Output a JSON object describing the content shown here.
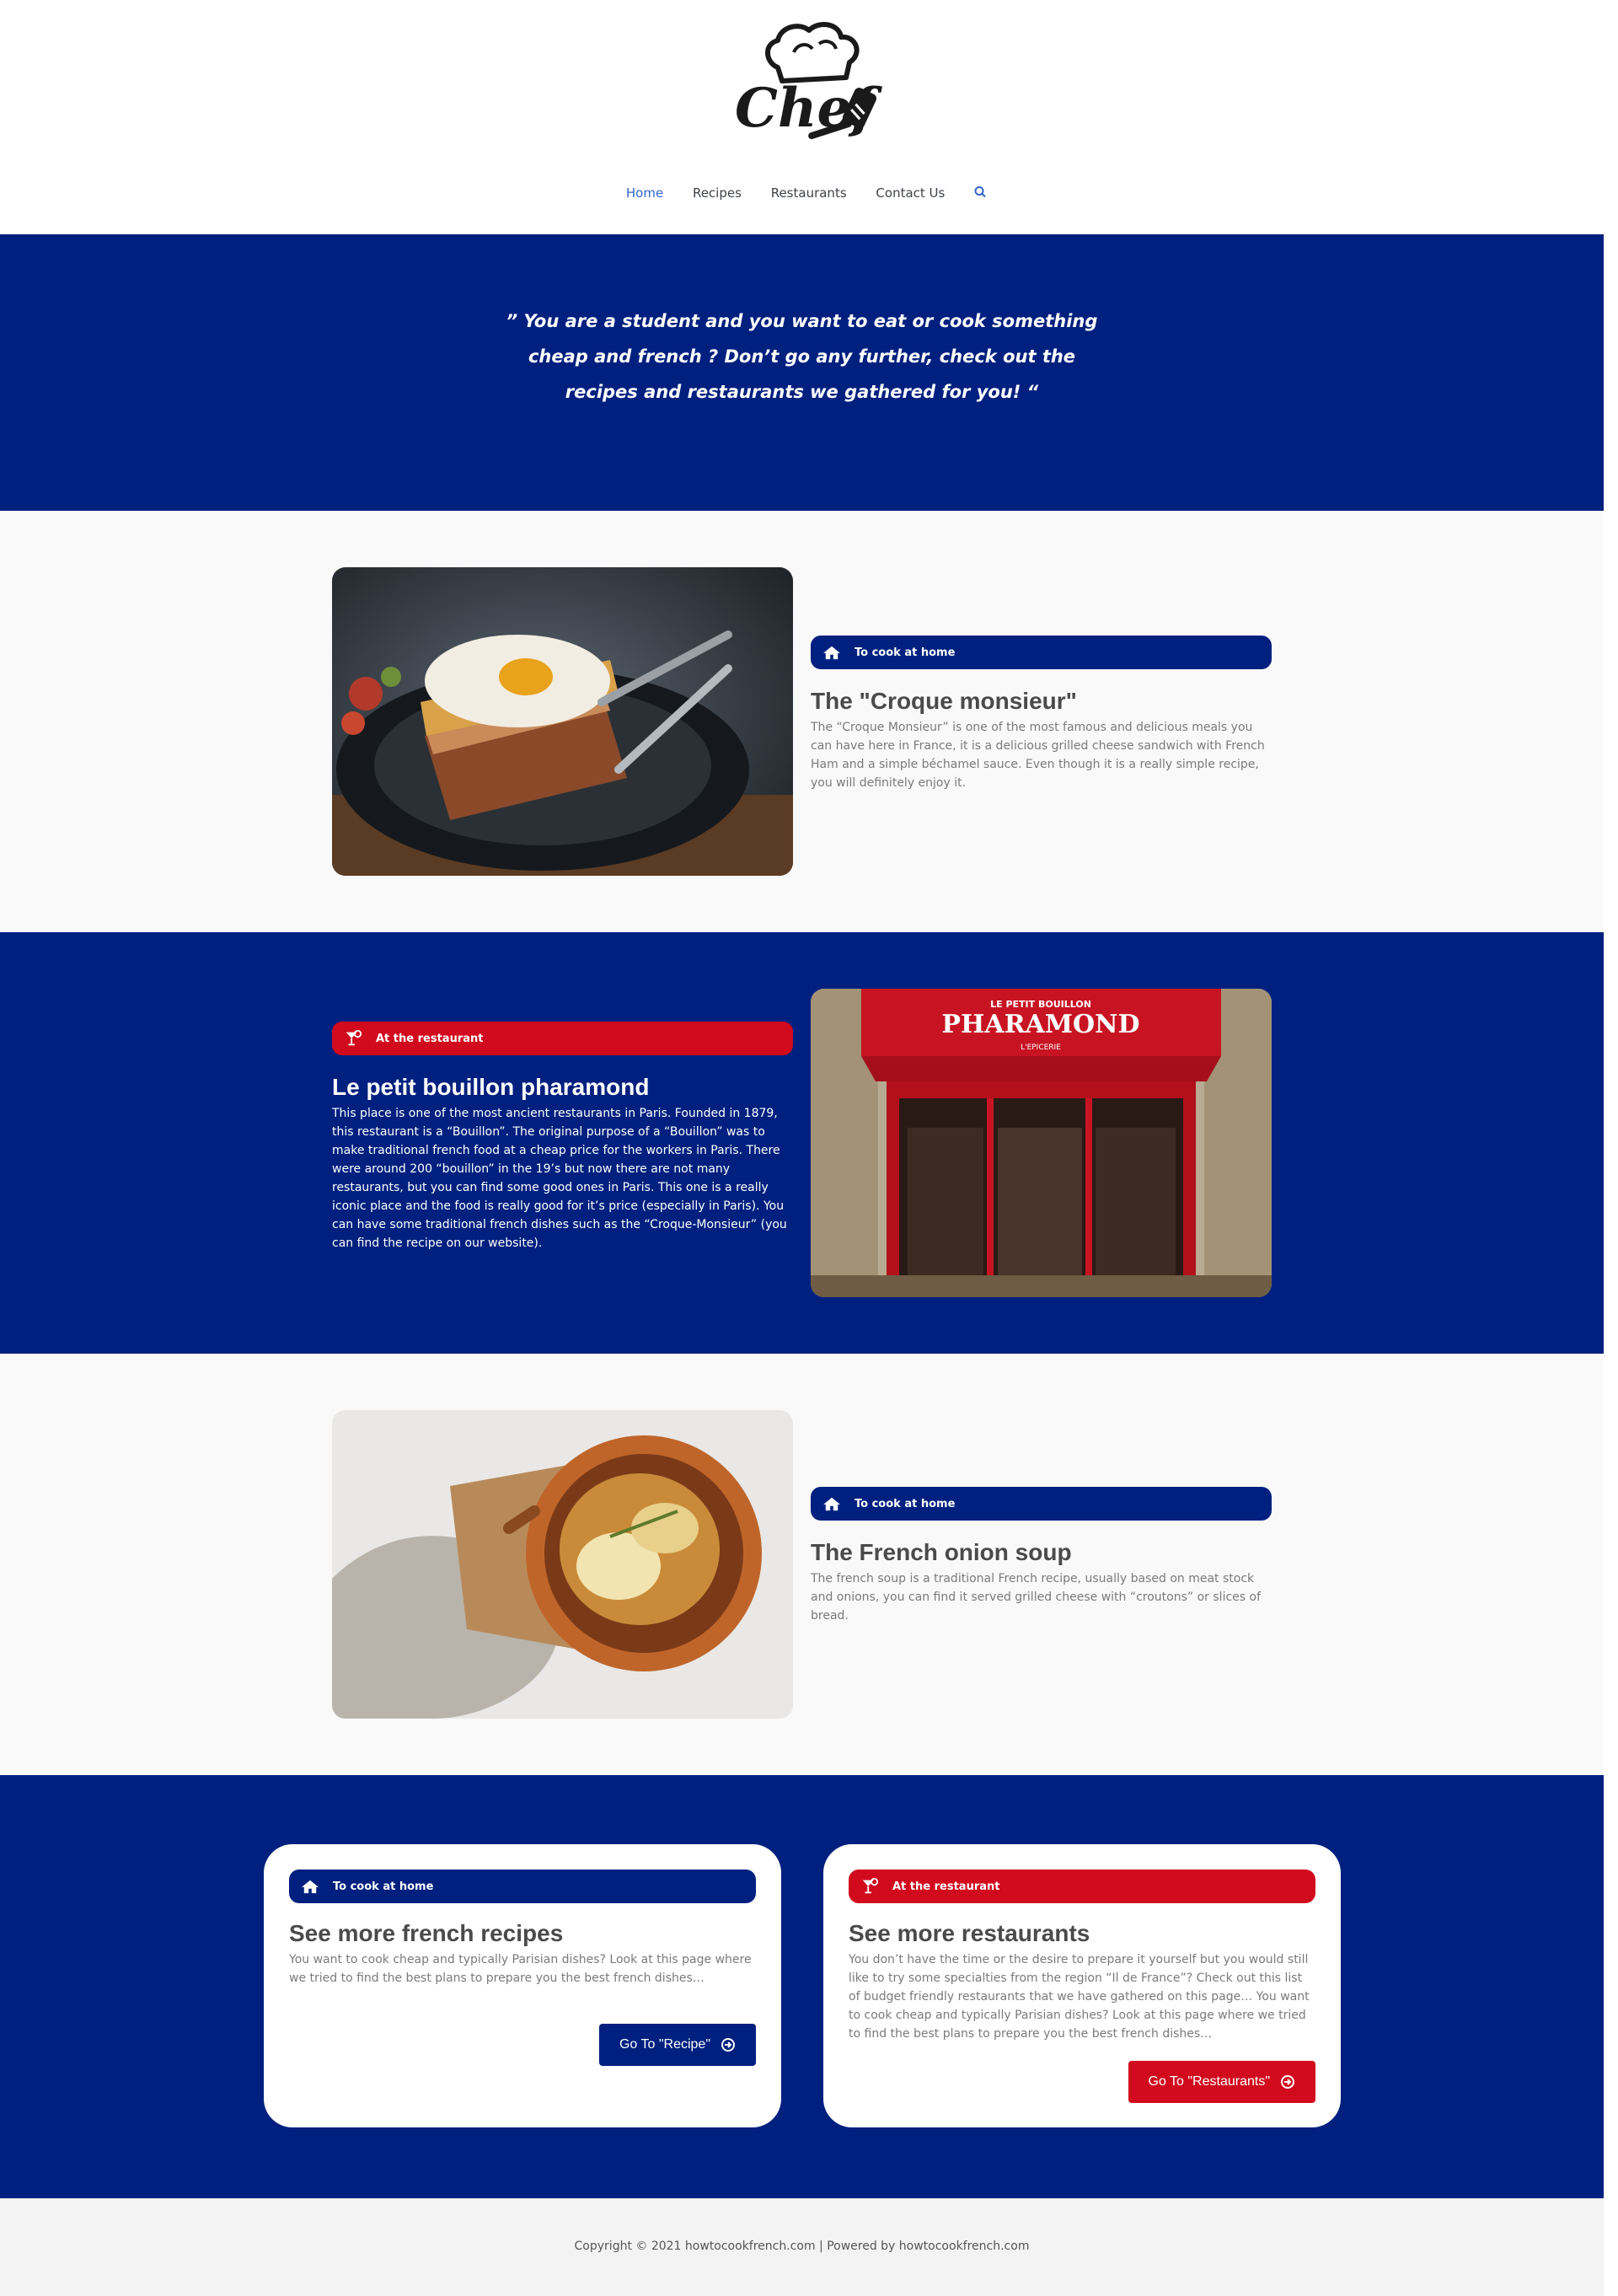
{
  "header": {
    "logo_text": "Chef",
    "nav": [
      {
        "label": "Home",
        "active": true
      },
      {
        "label": "Recipes",
        "active": false
      },
      {
        "label": "Restaurants",
        "active": false
      },
      {
        "label": "Contact Us",
        "active": false
      }
    ],
    "search_icon": "search-icon"
  },
  "hero": {
    "quote": "” You are a student and you want to eat or cook something cheap and french ? Don’t go any further, check out the recipes and restaurants we gathered for you! “"
  },
  "features": [
    {
      "tag": "To cook at home",
      "tag_icon": "home-icon",
      "title": "The \"Croque monsieur\"",
      "description": "The “Croque Monsieur” is one of the most famous and delicious meals you can have here in France, it is a delicious grilled cheese sandwich with French Ham and a simple béchamel sauce. Even though it is a really simple recipe, you will definitely enjoy it.",
      "image": "croque-monsieur-photo"
    },
    {
      "tag": "At the restaurant",
      "tag_icon": "cocktail-icon",
      "title": "Le petit bouillon pharamond",
      "description": "This place is one of the most ancient restaurants in Paris. Founded in 1879, this restaurant is a “Bouillon”. The original purpose of a “Bouillon” was to make traditional french food at a cheap price for the workers in Paris. There were around 200 “bouillon” in the 19’s but now there are not many restaurants, but you can find some good ones in Paris. This one is a really iconic place and the food is really good for it’s price (especially in Paris). You can have some traditional french dishes such as the “Croque-Monsieur” (you can find the recipe on our website).",
      "image": "pharamond-storefront-photo",
      "sign_top": "LE PETIT BOUILLON",
      "sign_main": "PHARAMOND",
      "sign_sub": "L'EPICERIE"
    },
    {
      "tag": "To cook at home",
      "tag_icon": "home-icon",
      "title": "The French onion soup",
      "description": "The french soup is a traditional French recipe, usually based on meat stock and onions, you can find it served grilled cheese with “croutons” or slices of bread.",
      "image": "onion-soup-photo"
    }
  ],
  "cards": [
    {
      "tag": "To cook at home",
      "tag_icon": "home-icon",
      "title": "See more french recipes",
      "description": "You want to cook cheap and typically Parisian dishes? Look at this page where we tried to find the best plans to prepare you the best french dishes…",
      "button": "Go To \"Recipe\""
    },
    {
      "tag": "At the restaurant",
      "tag_icon": "cocktail-icon",
      "title": "See more restaurants",
      "description": "You don’t have the time or the desire to prepare it yourself but you would still like to try some specialties from the region “Il de France”? Check out this list of budget friendly restaurants that we have gathered on this page… You want to cook cheap and typically Parisian dishes? Look at this page where we tried to find the best plans to prepare you the best french dishes…",
      "button": "Go To \"Restaurants\""
    }
  ],
  "footer": {
    "text": "Copyright © 2021 howtocookfrench.com | Powered by howtocookfrench.com"
  },
  "colors": {
    "brand_blue": "#00207f",
    "brand_red": "#d10a1e",
    "nav_active": "#3366cc"
  }
}
